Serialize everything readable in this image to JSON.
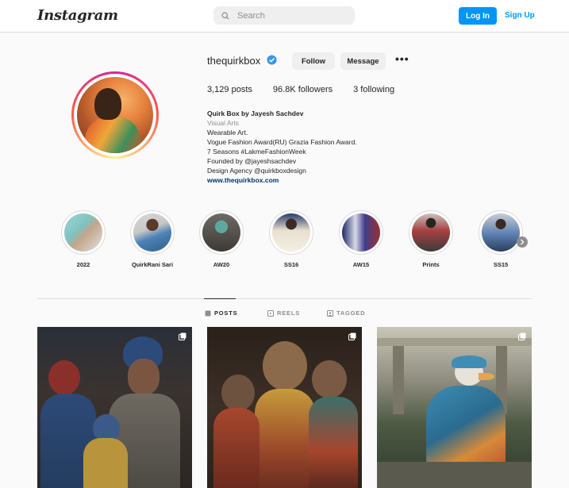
{
  "header": {
    "logo": "Instagram",
    "search_placeholder": "Search",
    "login_label": "Log In",
    "signup_label": "Sign Up"
  },
  "profile": {
    "username": "thequirkbox",
    "verified": true,
    "follow_label": "Follow",
    "message_label": "Message",
    "more_label": "•••",
    "stats": {
      "posts": "3,129",
      "posts_label": "posts",
      "followers": "96.8K",
      "followers_label": "followers",
      "following": "3",
      "following_label": "following"
    },
    "bio": {
      "name": "Quirk Box by Jayesh Sachdev",
      "category": "Visual Arts",
      "lines": [
        "Wearable Art.",
        "Vogue Fashion Award(RU) Grazia Fashion Award.",
        "7 Seasons #LakmeFashionWeek",
        "Founded by @jayeshsachdev",
        "Design Agency @quirkboxdesign"
      ],
      "link": "www.thequirkbox.com"
    }
  },
  "highlights": [
    {
      "label": "2022"
    },
    {
      "label": "QuirkRani Sari"
    },
    {
      "label": "AW20"
    },
    {
      "label": "SS16"
    },
    {
      "label": "AW15"
    },
    {
      "label": "Prints"
    },
    {
      "label": "SS15"
    }
  ],
  "tabs": [
    {
      "label": "POSTS",
      "icon": "grid-icon",
      "active": true
    },
    {
      "label": "REELS",
      "icon": "reels-icon",
      "active": false
    },
    {
      "label": "TAGGED",
      "icon": "tagged-icon",
      "active": false
    }
  ],
  "colors": {
    "accent": "#0095f6",
    "verified": "#3897f0",
    "link": "#00376b"
  }
}
